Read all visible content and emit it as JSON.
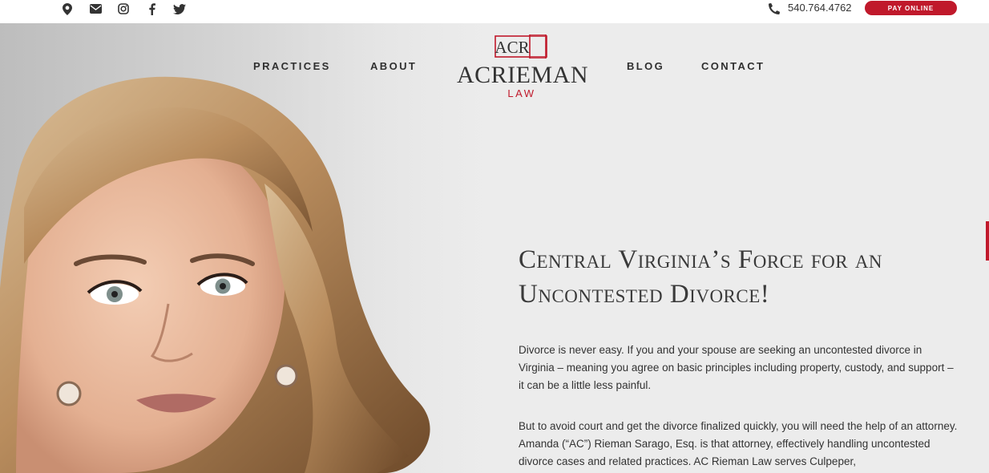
{
  "topbar": {
    "icons": [
      "map-marker-icon",
      "envelope-icon",
      "instagram-icon",
      "facebook-icon",
      "twitter-icon"
    ],
    "phone": "540.764.4762",
    "pay_label": "PAY ONLINE",
    "accent_color": "#c0192b"
  },
  "nav": {
    "practices": "PRACTICES",
    "about": "ABOUT",
    "blog": "BLOG",
    "contact": "CONTACT"
  },
  "logo": {
    "mark": "ACR",
    "name": "ACRIEMAN",
    "law": "LAW"
  },
  "hero": {
    "headline": "Central Virginia’s Force for an Uncontested Divorce!",
    "paragraph1": "Divorce is never easy. If you and your spouse are seeking an uncontested divorce in Virginia – meaning you agree on basic principles including property, custody, and support – it can be a little less painful.",
    "paragraph2": "But to avoid court and get the divorce finalized quickly, you will need the help of an attorney. Amanda (“AC”) Rieman Sarago, Esq. is that attorney, effectively handling uncontested divorce cases and related practices. AC Rieman Law serves Culpeper,"
  }
}
